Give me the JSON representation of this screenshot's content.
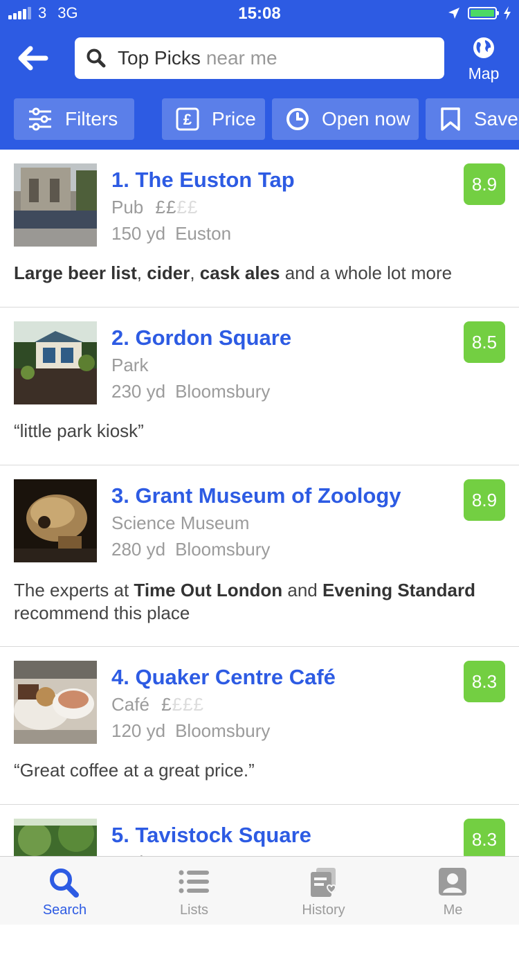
{
  "status_bar": {
    "carrier": "3",
    "network": "3G",
    "time": "15:08"
  },
  "header": {
    "search_query": "Top Picks",
    "search_placeholder": "near me",
    "map_label": "Map"
  },
  "filters": [
    {
      "label": "Filters",
      "icon": "sliders-icon"
    },
    {
      "label": "Price",
      "icon": "pound-icon"
    },
    {
      "label": "Open now",
      "icon": "clock-icon"
    },
    {
      "label": "Saved",
      "icon": "bookmark-icon"
    }
  ],
  "results": [
    {
      "title": "1. The Euston Tap",
      "category": "Pub",
      "price_on": "££",
      "price_off": "££",
      "distance": "150 yd",
      "area": "Euston",
      "score": "8.9",
      "tip": [
        {
          "t": "Large beer list",
          "b": true
        },
        {
          "t": ", ",
          "b": false
        },
        {
          "t": "cider",
          "b": true
        },
        {
          "t": ", ",
          "b": false
        },
        {
          "t": "cask ales",
          "b": true
        },
        {
          "t": " and a whole lot more",
          "b": false
        }
      ]
    },
    {
      "title": "2. Gordon Square",
      "category": "Park",
      "price_on": "",
      "price_off": "",
      "distance": "230 yd",
      "area": "Bloomsbury",
      "score": "8.5",
      "tip": [
        {
          "t": "“little park kiosk”",
          "b": false
        }
      ]
    },
    {
      "title": "3. Grant Museum of Zoology",
      "category": "Science Museum",
      "price_on": "",
      "price_off": "",
      "distance": "280 yd",
      "area": "Bloomsbury",
      "score": "8.9",
      "tip": [
        {
          "t": "The experts at ",
          "b": false
        },
        {
          "t": "Time Out London",
          "b": true
        },
        {
          "t": " and ",
          "b": false
        },
        {
          "t": "Evening Standard",
          "b": true
        },
        {
          "t": " recommend this place",
          "b": false
        }
      ]
    },
    {
      "title": "4. Quaker Centre Café",
      "category": "Café",
      "price_on": "£",
      "price_off": "£££",
      "distance": "120 yd",
      "area": "Bloomsbury",
      "score": "8.3",
      "tip": [
        {
          "t": "“Great coffee at a great price.”",
          "b": false
        }
      ]
    },
    {
      "title": "5. Tavistock Square",
      "category": "Park",
      "price_on": "",
      "price_off": "",
      "distance": "",
      "area": "",
      "score": "8.3",
      "tip": []
    }
  ],
  "tabs": [
    {
      "label": "Search",
      "icon": "search-icon",
      "active": true
    },
    {
      "label": "Lists",
      "icon": "list-icon",
      "active": false
    },
    {
      "label": "History",
      "icon": "history-icon",
      "active": false
    },
    {
      "label": "Me",
      "icon": "profile-icon",
      "active": false
    }
  ],
  "colors": {
    "brand_blue": "#2d5be3",
    "score_green": "#73cf42",
    "muted_text": "#9b9b9b"
  }
}
